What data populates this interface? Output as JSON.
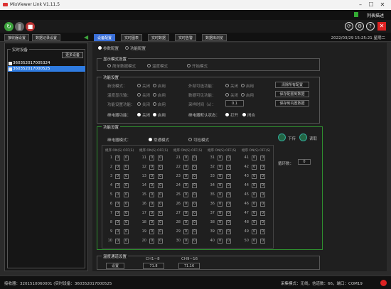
{
  "app": {
    "title": "MixViewer Link V1.11.5"
  },
  "window_controls": [
    "–",
    "☐",
    "✕"
  ],
  "topbar": {
    "list_label": "列表描述"
  },
  "tabs": [
    {
      "label": "接收器设置"
    },
    {
      "label": "数据记录设置"
    }
  ],
  "right_tabs": [
    {
      "label": "设备配置",
      "active": true
    },
    {
      "label": "实时图表"
    },
    {
      "label": "实时数据"
    },
    {
      "label": "实时告警"
    },
    {
      "label": "数据库浏览"
    }
  ],
  "timestamp": "2022/03/29 15:25:21 星期二",
  "left": {
    "group_title": "实时设备",
    "more_button": "更多设备",
    "devices": [
      {
        "id": "360352017005324",
        "selected": false
      },
      {
        "id": "360352017000525",
        "selected": true
      }
    ]
  },
  "config_mode": {
    "options": [
      {
        "label": "参数配置",
        "on": true
      },
      {
        "label": "功能配置",
        "on": false
      }
    ]
  },
  "display_mode": {
    "title": "显示模式设置",
    "options": [
      {
        "label": "简单数据模式",
        "on": false
      },
      {
        "label": "温度模式",
        "on": false
      },
      {
        "label": "开始模式",
        "on": false
      }
    ]
  },
  "func": {
    "title": "功能设置",
    "rows": [
      {
        "label": "新设模式：",
        "a": "关闭",
        "b": "启用",
        "label2": "外部可选功能：",
        "c": "关闭",
        "d": "启用",
        "btn": "清除所有配置"
      },
      {
        "label": "温度显示输：",
        "a": "关闭",
        "b": "启用",
        "label2": "数据可见功能：",
        "c": "关闭",
        "d": "启用",
        "btn": "保存配置到数据"
      },
      {
        "label": "功能设置功能：",
        "a": "关闭",
        "b": "启用",
        "label2": "采样时间（s）：",
        "value": "0.1",
        "btn": "保存到内置数据"
      }
    ],
    "relay_row": {
      "label": "继电器功能：",
      "a": "关闭",
      "b": "启用",
      "label2": "继电器默认状态：",
      "c": "打开",
      "d": "闭合"
    }
  },
  "relay": {
    "title": "功能设置",
    "mode_label": "继电器模式：",
    "mode_options": [
      {
        "label": "常通模式",
        "on": true
      },
      {
        "label": "可检模式",
        "on": false
      }
    ],
    "btn_down": "下传",
    "btn_read": "读取",
    "header": "继序 ON(S) OFF(S)",
    "cell_value": "0",
    "delay_label": "循环数：",
    "delay_value": "0",
    "columns": [
      [
        1,
        2,
        3,
        4,
        5,
        6,
        7,
        8,
        9,
        10
      ],
      [
        11,
        12,
        13,
        14,
        15,
        16,
        17,
        18,
        19,
        20
      ],
      [
        21,
        22,
        23,
        24,
        25,
        26,
        27,
        28,
        29,
        30
      ],
      [
        31,
        32,
        33,
        34,
        35,
        36,
        37,
        38,
        39,
        40
      ],
      [
        41,
        42,
        43,
        44,
        45,
        46,
        47,
        48,
        49,
        50
      ]
    ]
  },
  "channel": {
    "title": "温度通道设置",
    "btn": "设置",
    "ch1_label": "CH1~8",
    "ch1_value": "71.8",
    "ch2_label": "CH9~16",
    "ch2_value": "71.16"
  },
  "status": {
    "left": "接收器：3201510060001 (实时设备：360352017000525",
    "right": "采集模式：无线，信道数：66，端口：COM19"
  },
  "colors": {
    "accent": "#3a6fd8",
    "selected": "#2f7be0",
    "green_border": "#2f8f2f"
  }
}
